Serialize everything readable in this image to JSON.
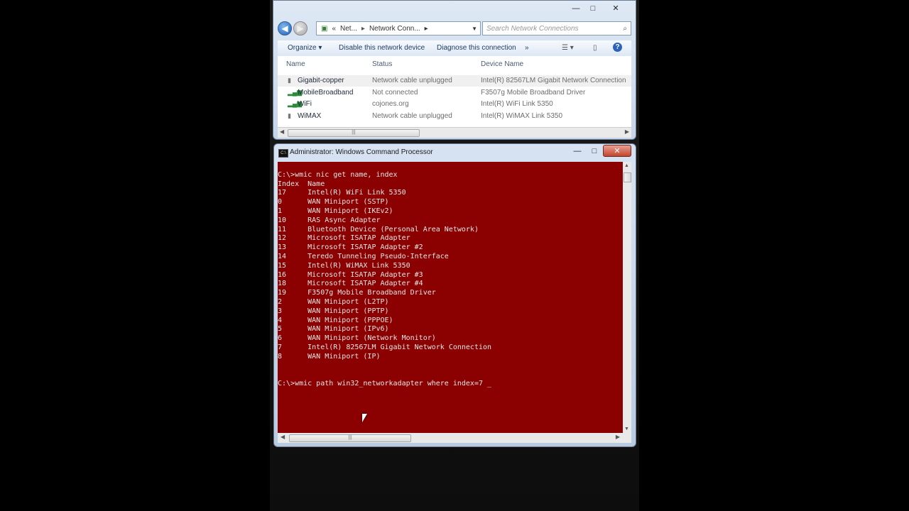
{
  "explorer": {
    "window_controls": {
      "minimize": "—",
      "maximize": "□",
      "close": "✕"
    },
    "breadcrumb": [
      "«",
      "Net...",
      "Network Conn...",
      "▸"
    ],
    "search_placeholder": "Search Network Connections",
    "toolbar": {
      "organize": "Organize ▾",
      "disable": "Disable this network device",
      "diagnose": "Diagnose this connection",
      "more": "»"
    },
    "columns": [
      "Name",
      "Status",
      "Device Name"
    ],
    "rows": [
      {
        "name": "Gigabit-copper",
        "status": "Network cable unplugged",
        "device": "Intel(R) 82567LM Gigabit Network Connection"
      },
      {
        "name": "MobileBroadband",
        "status": "Not connected",
        "device": "F3507g Mobile Broadband Driver"
      },
      {
        "name": "WiFi",
        "status": "cojones.org",
        "device": "Intel(R) WiFi Link 5350"
      },
      {
        "name": "WiMAX",
        "status": "Network cable unplugged",
        "device": "Intel(R) WiMAX Link 5350"
      }
    ]
  },
  "cmd": {
    "title": "Administrator: Windows Command Processor",
    "window_controls": {
      "minimize": "—",
      "maximize": "□",
      "close": "✕"
    },
    "lines": [
      "",
      "C:\\>wmic nic get name, index",
      "Index  Name",
      "17     Intel(R) WiFi Link 5350",
      "0      WAN Miniport (SSTP)",
      "1      WAN Miniport (IKEv2)",
      "10     RAS Async Adapter",
      "11     Bluetooth Device (Personal Area Network)",
      "12     Microsoft ISATAP Adapter",
      "13     Microsoft ISATAP Adapter #2",
      "14     Teredo Tunneling Pseudo-Interface",
      "15     Intel(R) WiMAX Link 5350",
      "16     Microsoft ISATAP Adapter #3",
      "18     Microsoft ISATAP Adapter #4",
      "19     F3507g Mobile Broadband Driver",
      "2      WAN Miniport (L2TP)",
      "3      WAN Miniport (PPTP)",
      "4      WAN Miniport (PPPOE)",
      "5      WAN Miniport (IPv6)",
      "6      WAN Miniport (Network Monitor)",
      "7      Intel(R) 82567LM Gigabit Network Connection",
      "8      WAN Miniport (IP)",
      "",
      "",
      "C:\\>wmic path win32_networkadapter where index=7 _"
    ]
  }
}
